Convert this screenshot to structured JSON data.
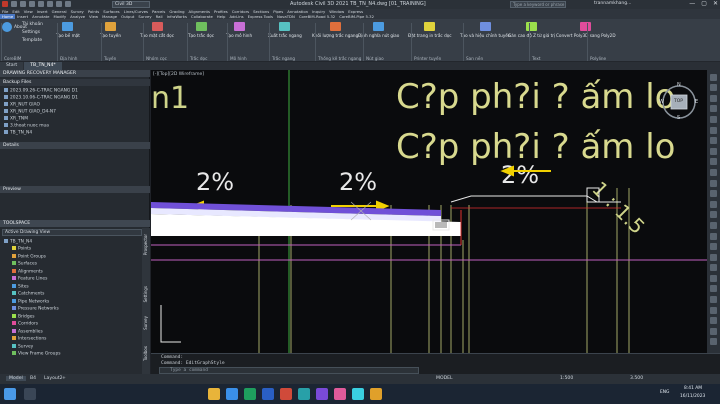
{
  "titlebar": {
    "app_dropdown": "Civil 3D",
    "title": "Autodesk Civil 3D 2021   TB_TN_N4.dwg [01_TRAINING]",
    "search_placeholder": "Type a keyword or phrase",
    "user": "trannamkhang...",
    "controls": [
      "—",
      "▢",
      "✕"
    ]
  },
  "menubar": {
    "items": [
      "File",
      "Edit",
      "View",
      "Insert",
      "General",
      "Survey",
      "Points",
      "Surfaces",
      "Lines/Curves",
      "Parcels",
      "Grading",
      "Alignments",
      "Profiles",
      "Corridors",
      "Sections",
      "Pipes",
      "Annotation",
      "Inquiry",
      "Window",
      "Express"
    ],
    "ribbon_tabs": [
      "Home",
      "Insert",
      "Annotate",
      "Modify",
      "Analyze",
      "View",
      "Manage",
      "Output",
      "Survey",
      "Rail",
      "InfraWorks",
      "Collaborate",
      "Help",
      "Add-ins",
      "Express Tools",
      "NovaTDN",
      "CoreBIM-Road 5.32",
      "CoreBIM-Pipe 5.32"
    ]
  },
  "ribbon": {
    "account": {
      "label": "About",
      "items": [
        "Tài khoản",
        "Settings",
        "Template"
      ]
    },
    "tools": [
      {
        "label": "Tạo bề mặt",
        "color": "#4c9be0"
      },
      {
        "label": "Tạo tuyến",
        "color": "#e0a23c"
      },
      {
        "label": "Tạo mặt cắt dọc",
        "color": "#d85b5b"
      },
      {
        "label": "Tạo trắc dọc",
        "color": "#6fbf5e"
      },
      {
        "label": "Tạo mô hình",
        "color": "#c86fd6"
      },
      {
        "label": "Xuất trắc ngang",
        "color": "#57c2c2"
      },
      {
        "label": "Khối lượng trắc ngang",
        "color": "#e06f3c"
      },
      {
        "label": "Định nghĩa nút giao",
        "color": "#4c9be0"
      },
      {
        "label": "Đặt trang in trắc dọc",
        "color": "#e0d33c"
      },
      {
        "label": "Tạo và hiệu chỉnh tuyến",
        "color": "#6f8fe0"
      },
      {
        "label": "Gán cao độ Z từ giá trị",
        "color": "#9be04c"
      },
      {
        "label": "Convert Poly3D sang Poly2D",
        "color": "#e04c9b"
      }
    ],
    "panels": [
      "CoreBIM",
      "Địa hình",
      "Tuyến",
      "Nhóm cọc",
      "Trắc dọc",
      "Mô hình",
      "Trắc ngang",
      "Thống kê trắc ngang",
      "Nút giao",
      "Printer tuyến",
      "San nền",
      "Text",
      "Polyline"
    ]
  },
  "doctabs": [
    "Start",
    "TB_TN_N4*"
  ],
  "leftpanel": {
    "recovery_title": "DRAWING RECOVERY MANAGER",
    "backup_label": "Backup Files",
    "backup_files": [
      "2023.09.26-C-TRAC NGANG D1",
      "2023.10.06-C-TRAC NGANG D1",
      "XR_NUT GIAO",
      "XR_NUT GIAO_D4-N7",
      "XR_TNM",
      "3.thoat nuoc mua",
      "TB_TN_N4"
    ],
    "details_label": "Details",
    "preview_label": "Preview",
    "toolspace_title": "TOOLSPACE",
    "toolspace_view": "Active Drawing View",
    "tree_root": "TB_TN_N4",
    "tree_items": [
      "Points",
      "Point Groups",
      "Surfaces",
      "Alignments",
      "Feature Lines",
      "Sites",
      "Catchments",
      "Pipe Networks",
      "Pressure Networks",
      "Bridges",
      "Corridors",
      "Assemblies",
      "Intersections",
      "Survey",
      "View Frame Groups"
    ],
    "side_tabs": [
      "Prospector",
      "Settings",
      "Survey",
      "Toolbox"
    ]
  },
  "drawing": {
    "viewport_label": "[-][Top][2D Wireframe]",
    "big_text_1": "C?p ph?i ? ấm lo",
    "big_text_2": "C?p ph?i ? ấm lo",
    "partial_text": "n1",
    "slope_left": "2%",
    "slope_mid": "2%",
    "slope_right": "2%",
    "ratio": "1 : 1.5",
    "viewcube": {
      "top": "TOP",
      "n": "N",
      "s": "S",
      "w": "W",
      "e": "E"
    }
  },
  "command": {
    "line1": "Command:",
    "line2": "Command: EditGraphStyle",
    "placeholder": "Type a command"
  },
  "statusbar": {
    "tabs": [
      "Model",
      "B4",
      "Layout2"
    ],
    "mode": "MODEL",
    "scale": "1:500",
    "value": "3.500"
  },
  "taskbar": {
    "time": "8:41 AM",
    "date": "16/11/2023",
    "lang": "ENG"
  }
}
